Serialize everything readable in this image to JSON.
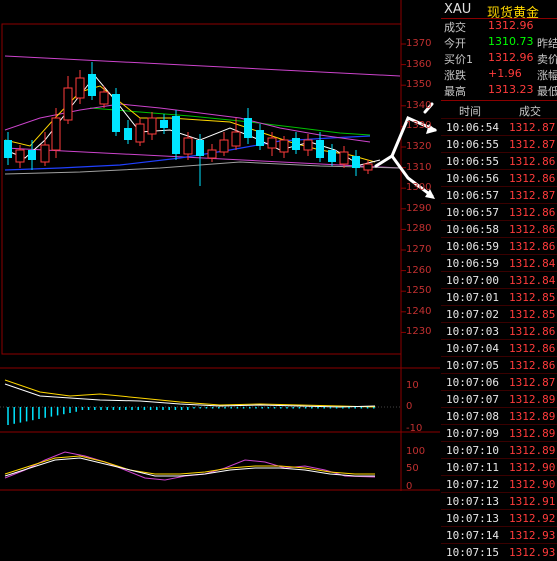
{
  "colors": {
    "background": "#000000",
    "up": "#ff3b3b",
    "down": "#00e5ff",
    "grid": "#8b0000",
    "accent_yellow": "#ffd700"
  },
  "chart": {
    "price_axis": [
      "1370",
      "1360",
      "1350",
      "1340",
      "1330",
      "1320",
      "1310",
      "1300",
      "1290",
      "1280",
      "1270",
      "1260",
      "1250",
      "1240",
      "1230"
    ],
    "macd_axis": [
      "10",
      "0",
      "-10"
    ],
    "kdj_axis": [
      "100",
      "50",
      "0"
    ]
  },
  "quote": {
    "symbol": "XAU",
    "name": "现货黄金",
    "rows": [
      {
        "label": "成交",
        "value": "1312.96",
        "value_color": "#ff3b3b",
        "extra": ""
      },
      {
        "label": "今开",
        "value": "1310.73",
        "value_color": "#00ff00",
        "extra": "昨结"
      },
      {
        "label": "买价1",
        "value": "1312.96",
        "value_color": "#ff3b3b",
        "extra": "卖价"
      },
      {
        "label": "涨跌",
        "value": "+1.96",
        "value_color": "#ff3b3b",
        "extra": "涨幅"
      },
      {
        "label": "最高",
        "value": "1313.23",
        "value_color": "#ff3b3b",
        "extra": "最低"
      }
    ]
  },
  "ticks": {
    "header_time": "时间",
    "header_price": "成交",
    "rows": [
      {
        "time": "10:06:54",
        "price": "1312.87"
      },
      {
        "time": "10:06:55",
        "price": "1312.87"
      },
      {
        "time": "10:06:55",
        "price": "1312.86"
      },
      {
        "time": "10:06:56",
        "price": "1312.86"
      },
      {
        "time": "10:06:57",
        "price": "1312.87"
      },
      {
        "time": "10:06:57",
        "price": "1312.86"
      },
      {
        "time": "10:06:58",
        "price": "1312.86"
      },
      {
        "time": "10:06:59",
        "price": "1312.86"
      },
      {
        "time": "10:06:59",
        "price": "1312.84"
      },
      {
        "time": "10:07:00",
        "price": "1312.84"
      },
      {
        "time": "10:07:01",
        "price": "1312.85"
      },
      {
        "time": "10:07:02",
        "price": "1312.85"
      },
      {
        "time": "10:07:03",
        "price": "1312.86"
      },
      {
        "time": "10:07:04",
        "price": "1312.86"
      },
      {
        "time": "10:07:05",
        "price": "1312.86"
      },
      {
        "time": "10:07:06",
        "price": "1312.87"
      },
      {
        "time": "10:07:07",
        "price": "1312.89"
      },
      {
        "time": "10:07:08",
        "price": "1312.89"
      },
      {
        "time": "10:07:09",
        "price": "1312.89"
      },
      {
        "time": "10:07:10",
        "price": "1312.89"
      },
      {
        "time": "10:07:11",
        "price": "1312.90"
      },
      {
        "time": "10:07:12",
        "price": "1312.90"
      },
      {
        "time": "10:07:13",
        "price": "1312.91"
      },
      {
        "time": "10:07:13",
        "price": "1312.92"
      },
      {
        "time": "10:07:14",
        "price": "1312.93"
      },
      {
        "time": "10:07:15",
        "price": "1312.93"
      }
    ]
  }
}
